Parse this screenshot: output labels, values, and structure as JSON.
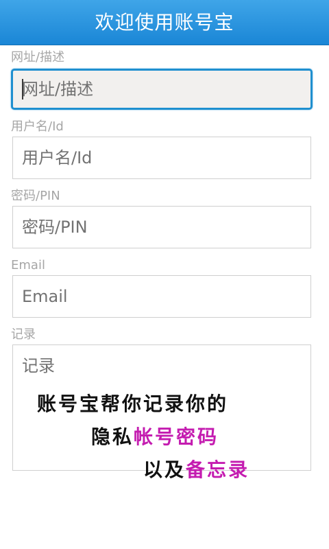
{
  "app": {
    "title": "欢迎使用账号宝"
  },
  "form": {
    "url": {
      "label": "网址/描述",
      "placeholder": "网址/描述"
    },
    "username": {
      "label": "用户名/Id",
      "placeholder": "用户名/Id"
    },
    "password": {
      "label": "密码/PIN",
      "placeholder": "密码/PIN"
    },
    "email": {
      "label": "Email",
      "placeholder": "Email"
    },
    "memo": {
      "label": "记录",
      "placeholder": "记录",
      "promo": {
        "line1": "账号宝帮你记录你的",
        "line2_prefix": "隐私",
        "line2_highlight": "帐号密码",
        "line3_prefix": "以及",
        "line3_highlight": "备忘录"
      }
    }
  },
  "colors": {
    "title_bar": "#1a86d6",
    "focus_border": "#1f8fcf",
    "label_gray": "#a6a6a6",
    "highlight_magenta": "#c41cb0"
  }
}
